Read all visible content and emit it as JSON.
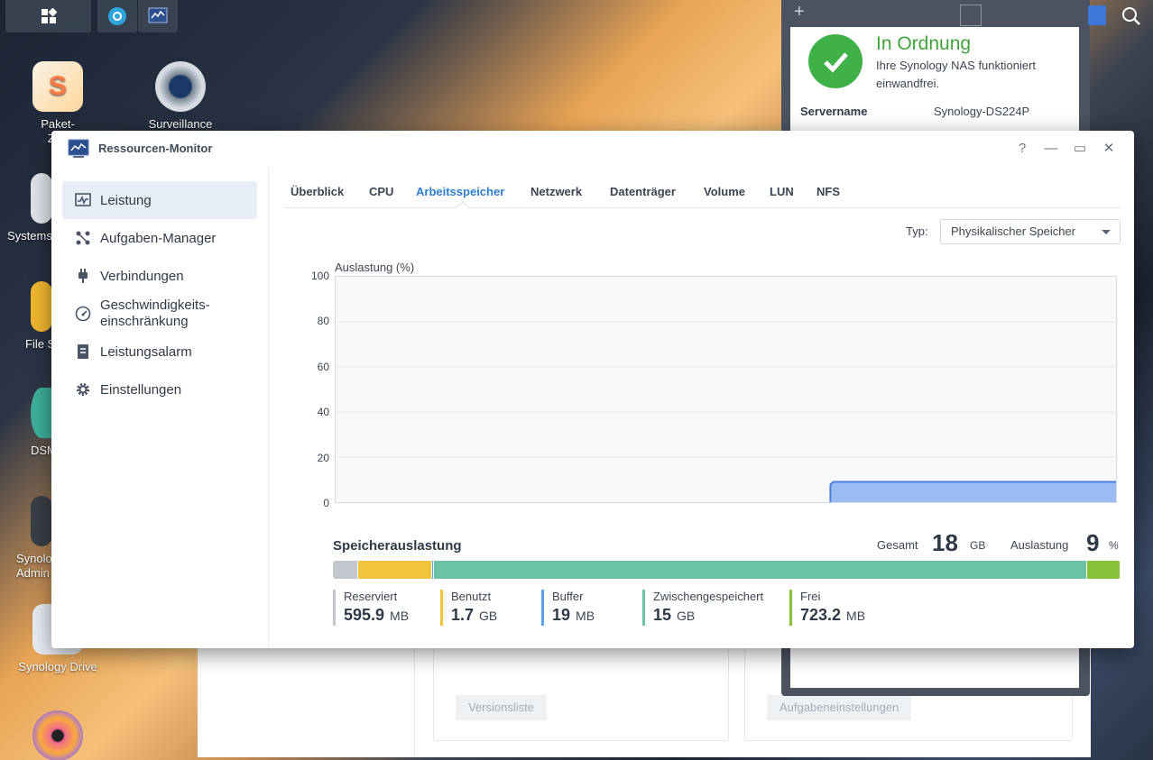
{
  "desktop": {
    "icons": [
      {
        "label": "Paket-\nZen"
      },
      {
        "label": "Surveillance Station"
      },
      {
        "label": "Systems"
      },
      {
        "label": "File S"
      },
      {
        "label": "DSM"
      },
      {
        "label": "Synolo\nAdmin"
      },
      {
        "label": "Synology Drive"
      }
    ]
  },
  "background_window": {
    "version_button": "Versionsliste",
    "task_button": "Aufgabeneinstellungen"
  },
  "notification": {
    "status_title": "In Ordnung",
    "status_text": "Ihre Synology NAS funktioniert einwandfrei.",
    "server_label": "Servername",
    "server_value": "Synology-DS224P"
  },
  "window": {
    "title": "Ressourcen-Monitor",
    "help": "?",
    "minimize": "—",
    "maximize": "▭",
    "close": "✕"
  },
  "sidebar": {
    "items": [
      {
        "label": "Leistung",
        "icon": "performance-icon"
      },
      {
        "label": "Aufgaben-Manager",
        "icon": "task-icon"
      },
      {
        "label": "Verbindungen",
        "icon": "plug-icon"
      },
      {
        "label": "Geschwindigkeits-\neinschränkung",
        "icon": "speed-icon"
      },
      {
        "label": "Leistungsalarm",
        "icon": "alarm-icon"
      },
      {
        "label": "Einstellungen",
        "icon": "gear-icon"
      }
    ]
  },
  "tabs": [
    "Überblick",
    "CPU",
    "Arbeitsspeicher",
    "Netzwerk",
    "Datenträger",
    "Volume",
    "LUN",
    "NFS"
  ],
  "active_tab": "Arbeitsspeicher",
  "filter": {
    "label": "Typ:",
    "value": "Physikalischer Speicher"
  },
  "chart_data": {
    "type": "area",
    "title": "Auslastung (%)",
    "ylim": [
      0,
      100
    ],
    "yticks": [
      "100",
      "80",
      "60",
      "40",
      "20",
      "0"
    ],
    "x_fraction_start": 0.634,
    "values_after_start": 9,
    "color": "#9bbcf2",
    "line_color": "#4a7fe0"
  },
  "memory": {
    "title": "Speicherauslastung",
    "total_label": "Gesamt",
    "total_value": "18",
    "total_unit": "GB",
    "usage_label": "Auslastung",
    "usage_value": "9",
    "usage_unit": "%",
    "segments": [
      {
        "name": "Reserviert",
        "value": "595.9",
        "unit": "MB",
        "color": "#c3c8d0",
        "share": 0.032
      },
      {
        "name": "Benutzt",
        "value": "1.7",
        "unit": "GB",
        "color": "#f0c43c",
        "share": 0.094
      },
      {
        "name": "Buffer",
        "value": "19",
        "unit": "MB",
        "color": "#5aa2f0",
        "share": 0.002
      },
      {
        "name": "Zwischengespeichert",
        "value": "15",
        "unit": "GB",
        "color": "#6cc3a4",
        "share": 0.83
      },
      {
        "name": "Frei",
        "value": "723.2",
        "unit": "MB",
        "color": "#86c23a",
        "share": 0.042
      }
    ]
  }
}
